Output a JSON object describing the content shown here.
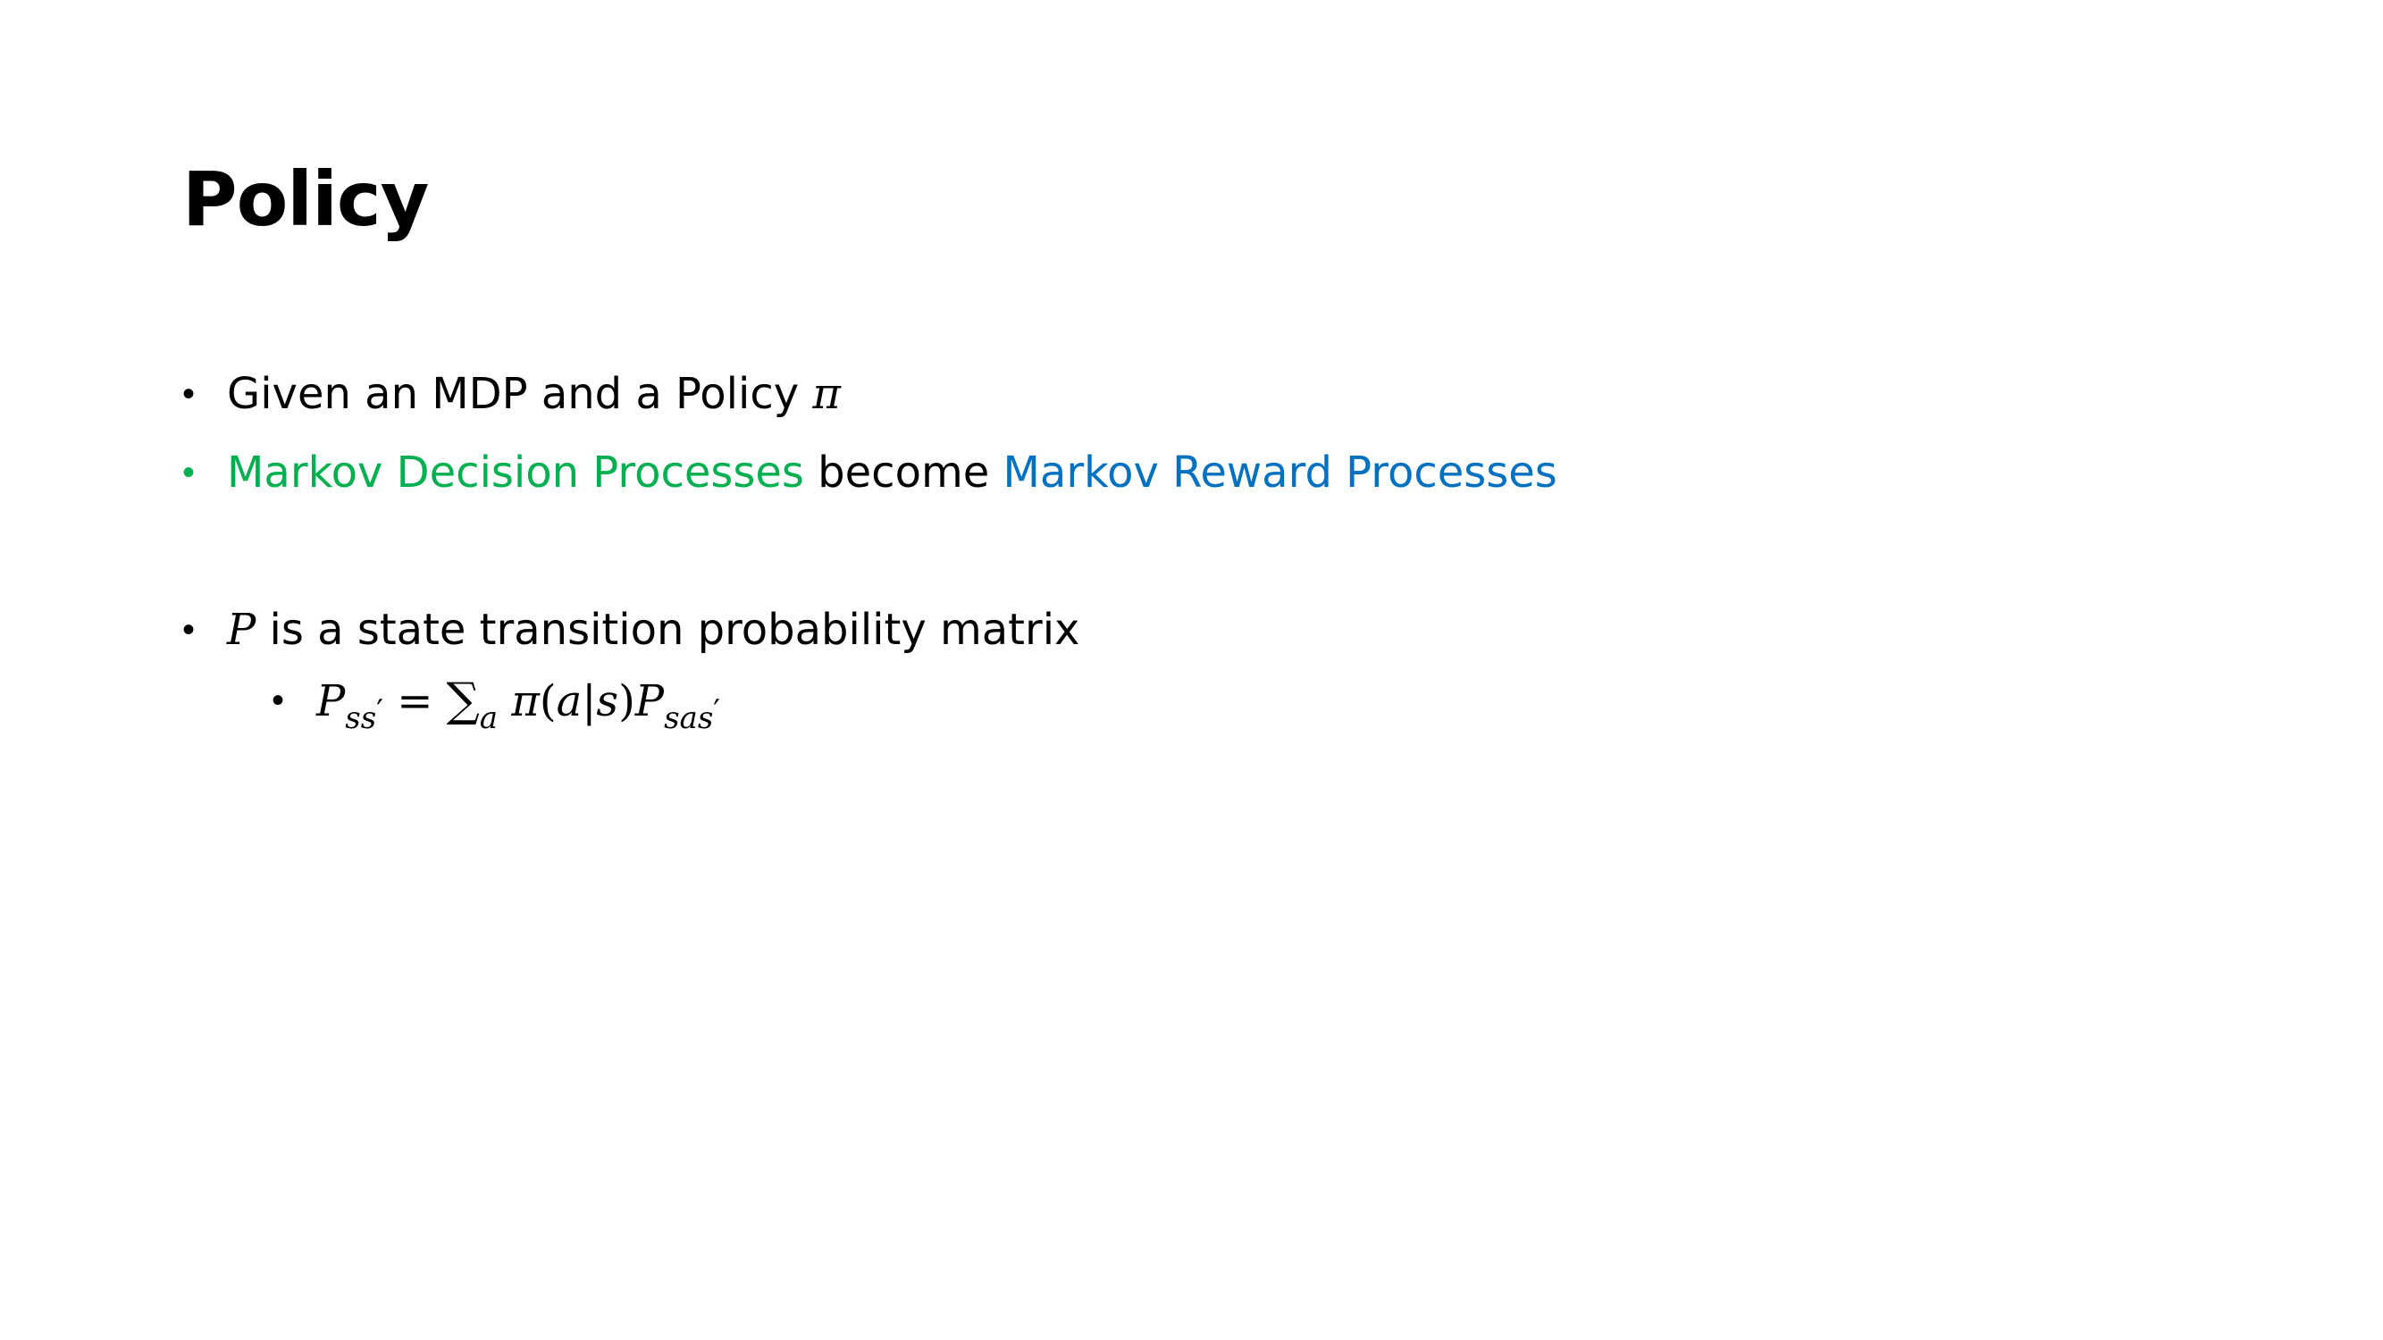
{
  "slide": {
    "title": "Policy",
    "bullets": [
      {
        "text": "Given an MDP and a Policy ",
        "symbol": "π"
      },
      {
        "part1": "Markov Decision Processes",
        "part2": " become ",
        "part3": "Markov Reward Processes"
      },
      {
        "symbol": "P",
        "text": " is a state transition probability matrix"
      }
    ],
    "formula": {
      "lhs_var": "P",
      "lhs_sub": "ss",
      "lhs_prime": "′",
      "equals": " = ",
      "sum": "∑",
      "sum_sub": "a",
      "policy": " π",
      "paren_open": "(",
      "arg_a": "a",
      "bar": "|",
      "arg_s": "s",
      "paren_close": ")",
      "rhs_var": "P",
      "rhs_sub": "sas",
      "rhs_prime": "′"
    },
    "bullet_glyph": "•"
  },
  "colors": {
    "text": "#000000",
    "green": "#00b050",
    "blue": "#0070c0",
    "background": "#ffffff"
  }
}
